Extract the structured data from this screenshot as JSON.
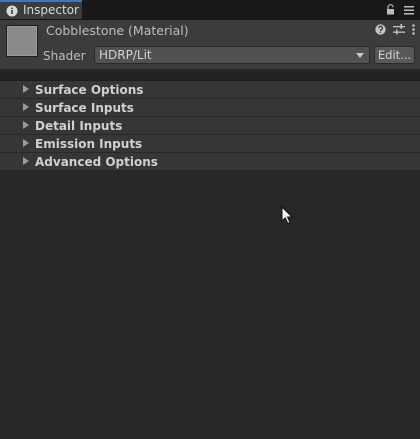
{
  "tab": {
    "title": "Inspector",
    "icon": "info-icon",
    "tools": [
      "lock-icon",
      "menu-icon"
    ]
  },
  "header": {
    "material_title": "Cobblestone (Material)",
    "shader_label": "Shader",
    "shader_value": "HDRP/Lit",
    "edit_label": "Edit...",
    "tools": [
      "help-icon",
      "settings-sliders-icon",
      "more-icon"
    ]
  },
  "foldouts": [
    {
      "label": "Surface Options",
      "expanded": false
    },
    {
      "label": "Surface Inputs",
      "expanded": false
    },
    {
      "label": "Detail Inputs",
      "expanded": false
    },
    {
      "label": "Emission Inputs",
      "expanded": false
    },
    {
      "label": "Advanced Options",
      "expanded": false
    }
  ],
  "colors": {
    "background": "#282828",
    "header": "#3c3c3c",
    "foldout": "#363636",
    "tab_accent": "#3a79bb"
  }
}
